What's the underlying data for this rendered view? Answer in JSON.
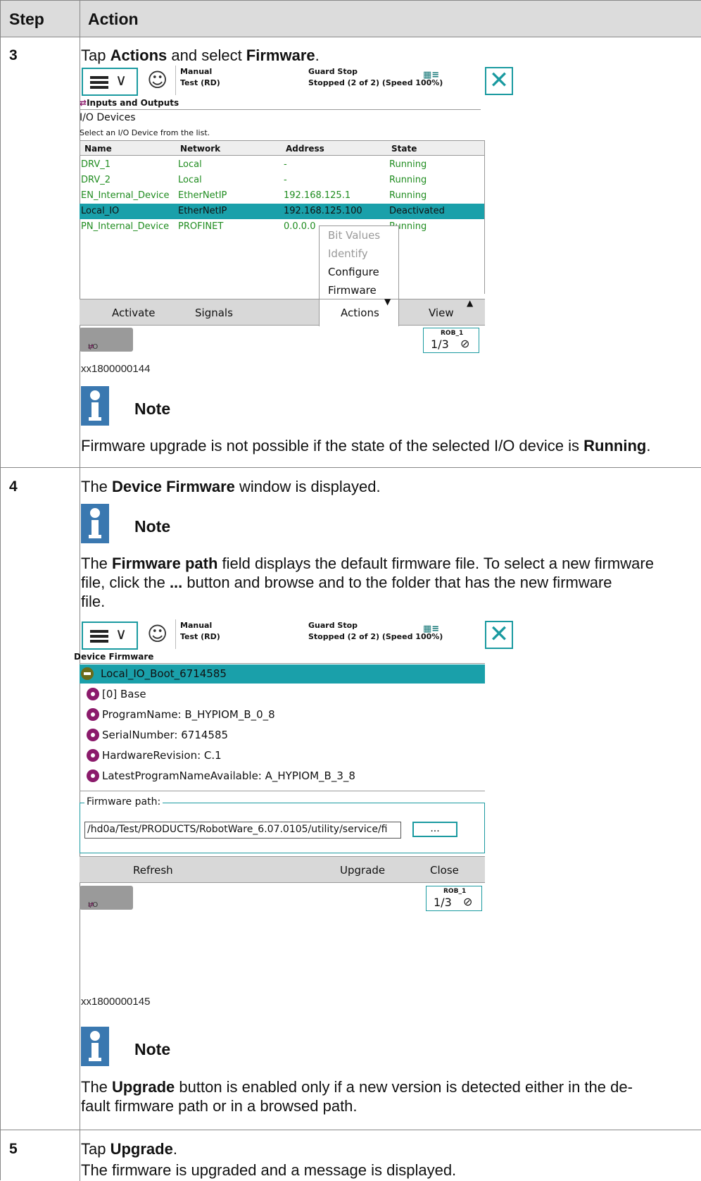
{
  "table": {
    "header_step": "Step",
    "header_action": "Action"
  },
  "step3": {
    "num": "3",
    "instr_pre": "Tap ",
    "instr_b1": "Actions",
    "instr_mid": " and select ",
    "instr_b2": "Firmware",
    "instr_end": ".",
    "caption": "xx1800000144",
    "note_title": "Note",
    "note_text_pre": "Firmware upgrade is not possible if the state of the selected I/O device is ",
    "note_text_b": "Running",
    "note_text_end": "."
  },
  "step4": {
    "num": "4",
    "instr_pre": "The ",
    "instr_b": "Device Firmware",
    "instr_end": " window is displayed.",
    "note_title": "Note",
    "note1_pre": "The ",
    "note1_b": "Firmware path",
    "note1_line1": " field displays the default firmware file. To select a new firmware",
    "note1_line2_pre": "file, click the ",
    "note1_line2_b": "...",
    "note1_line2_end": " button and browse and to the folder that has the new firmware",
    "note1_line3": "file.",
    "caption": "xx1800000145",
    "note2_title": "Note",
    "note2_pre": "The ",
    "note2_b": "Upgrade",
    "note2_line1": " button is enabled only if a new version is detected either in the de-",
    "note2_line2": "fault firmware path or in a browsed path."
  },
  "step5": {
    "num": "5",
    "instr_pre": "Tap ",
    "instr_b": "Upgrade",
    "instr_end": ".",
    "line2": "The firmware is upgraded and a message is displayed."
  },
  "status_bar": {
    "mode": "Manual",
    "mode_sub": "Test (RD)",
    "state": "Guard Stop",
    "state_sub": "Stopped (2 of 2) (Speed 100%)"
  },
  "io_screen": {
    "title": "Inputs and Outputs",
    "heading": "I/O Devices",
    "subheading": "Select an I/O Device from the list.",
    "columns": [
      "Name",
      "Network",
      "Address",
      "State"
    ],
    "rows": [
      {
        "name": "DRV_1",
        "network": "Local",
        "address": "-",
        "state": "Running"
      },
      {
        "name": "DRV_2",
        "network": "Local",
        "address": "-",
        "state": "Running"
      },
      {
        "name": "EN_Internal_Device",
        "network": "EtherNetIP",
        "address": "192.168.125.1",
        "state": "Running"
      },
      {
        "name": "Local_IO",
        "network": "EtherNetIP",
        "address": "192.168.125.100",
        "state": "Deactivated"
      },
      {
        "name": "PN_Internal_Device",
        "network": "PROFINET",
        "address": "0.0.0.0",
        "state": "Running"
      }
    ],
    "popup": [
      "Bit Values",
      "Identify",
      "Configure",
      "Firmware"
    ],
    "toolbar": [
      "Activate",
      "Signals",
      "Actions",
      "View"
    ],
    "io_button": "I/O",
    "rob_label": "ROB_1",
    "rob_fraction": "1/3"
  },
  "fw_screen": {
    "title": "Device Firmware",
    "root": "Local_IO_Boot_6714585",
    "items": [
      "[0] Base",
      "ProgramName: B_HYPIOM_B_0_8",
      "SerialNumber: 6714585",
      "HardwareRevision: C.1",
      "LatestProgramNameAvailable: A_HYPIOM_B_3_8"
    ],
    "path_label": "Firmware path:",
    "path_value": "/hd0a/Test/PRODUCTS/RobotWare_6.07.0105/utility/service/fi",
    "browse": "...",
    "toolbar": [
      "Refresh",
      "Upgrade",
      "Close"
    ],
    "io_button": "I/O",
    "rob_label": "ROB_1",
    "rob_fraction": "1/3"
  }
}
